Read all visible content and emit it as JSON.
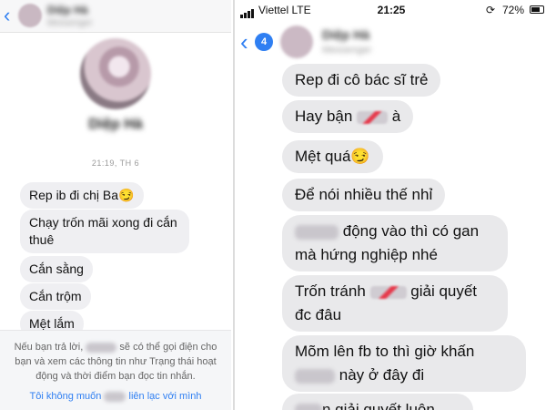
{
  "left": {
    "header": {
      "back_icon": "chevron-left-icon",
      "name": "Diệp Hà",
      "subtitle": "Messenger"
    },
    "profile": {
      "name": "Diệp Hà"
    },
    "timestamp": "21:19, TH 6",
    "messages": [
      {
        "text": "Rep ib đi chị Ba😏"
      },
      {
        "line1": "Chạy trốn mãi xong đi cắn",
        "line2": "thuê"
      },
      {
        "text": "Cắn sằng"
      },
      {
        "text": "Cắn trộm"
      },
      {
        "text": "Mệt lắm"
      }
    ],
    "notice": {
      "part1": "Nếu bạn trả lời,",
      "part2": "sẽ có thể gọi điện cho bạn và xem các thông tin như Trạng thái hoạt động và thời điểm bạn đọc tin nhắn.",
      "link_part1": "Tôi không muốn",
      "link_part2": "liên lạc với mình"
    }
  },
  "right": {
    "status": {
      "carrier": "Viettel",
      "network": "LTE",
      "time": "21:25",
      "battery": "72%",
      "battery_level": 0.72
    },
    "navbar": {
      "back_icon": "chevron-left-icon",
      "badge": "4",
      "name": "Diệp Hà",
      "subtitle": "Messenger"
    },
    "messages": [
      {
        "text": "Rep đi cô bác sĩ trẻ"
      },
      {
        "pre": "Hay bận",
        "post": " à"
      },
      {
        "text": "Mệt quá😏"
      },
      {
        "text": "Để nói nhiều thế nhỉ"
      },
      {
        "pre": "",
        "line1_post": "động vào thì có gan",
        "line2": "mà hứng nghiệp nhé"
      },
      {
        "pre": "Trốn tránh",
        "line1_post": " giải quyết",
        "line2": "đc đâu"
      },
      {
        "line1": "Mõm lên fb to thì giờ khấn",
        "line2_post": "này ở đây đi"
      },
      {
        "post": "n giải quyết luôn"
      }
    ]
  }
}
